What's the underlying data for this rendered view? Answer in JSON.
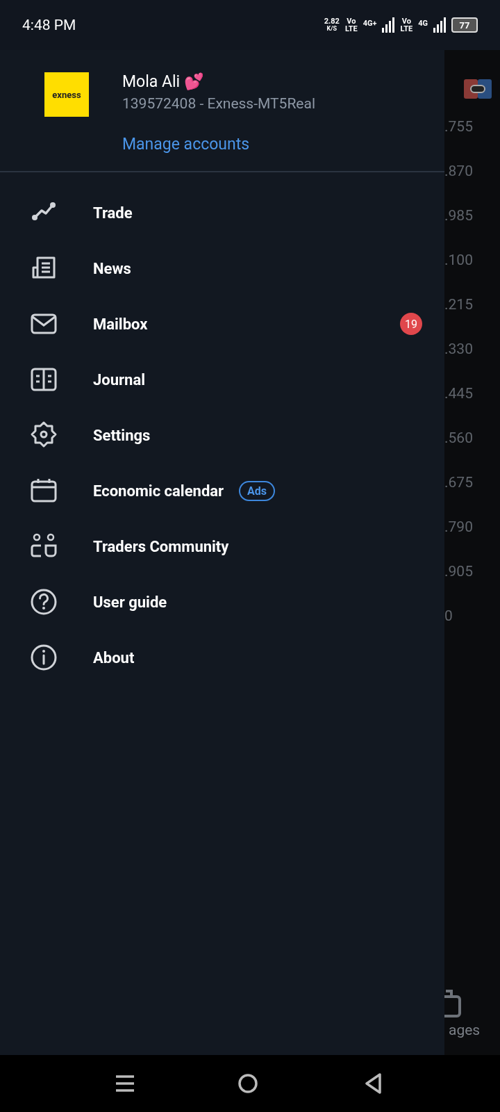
{
  "status_bar": {
    "time": "4:48 PM",
    "speed": "2.82",
    "speed_unit": "K/S",
    "sim1_volte": [
      "Vo",
      "LTE"
    ],
    "sim1_network": "4G+",
    "sim2_volte": [
      "Vo",
      "LTE"
    ],
    "sim2_network": "4G",
    "battery": "77"
  },
  "account": {
    "name": "Mola Ali 💕",
    "logo_text": "exness",
    "number": "139572408 - Exness-MT5Real",
    "manage_link": "Manage accounts"
  },
  "menu": [
    {
      "kind": "trade",
      "label": "Trade"
    },
    {
      "kind": "news",
      "label": "News"
    },
    {
      "kind": "mail",
      "label": "Mailbox",
      "badge": "19"
    },
    {
      "kind": "journal",
      "label": "Journal"
    },
    {
      "kind": "settings",
      "label": "Settings"
    },
    {
      "kind": "calendar",
      "label": "Economic calendar",
      "tag": "Ads"
    },
    {
      "kind": "community",
      "label": "Traders Community"
    },
    {
      "kind": "help",
      "label": "User guide"
    },
    {
      "kind": "about",
      "label": "About"
    }
  ],
  "background": {
    "price_labels": [
      ".755",
      ".870",
      ".985",
      ".100",
      ".215",
      ".330",
      ".445",
      ".560",
      ".675",
      ".790",
      ".905",
      "0"
    ],
    "tab_label": "ages"
  }
}
